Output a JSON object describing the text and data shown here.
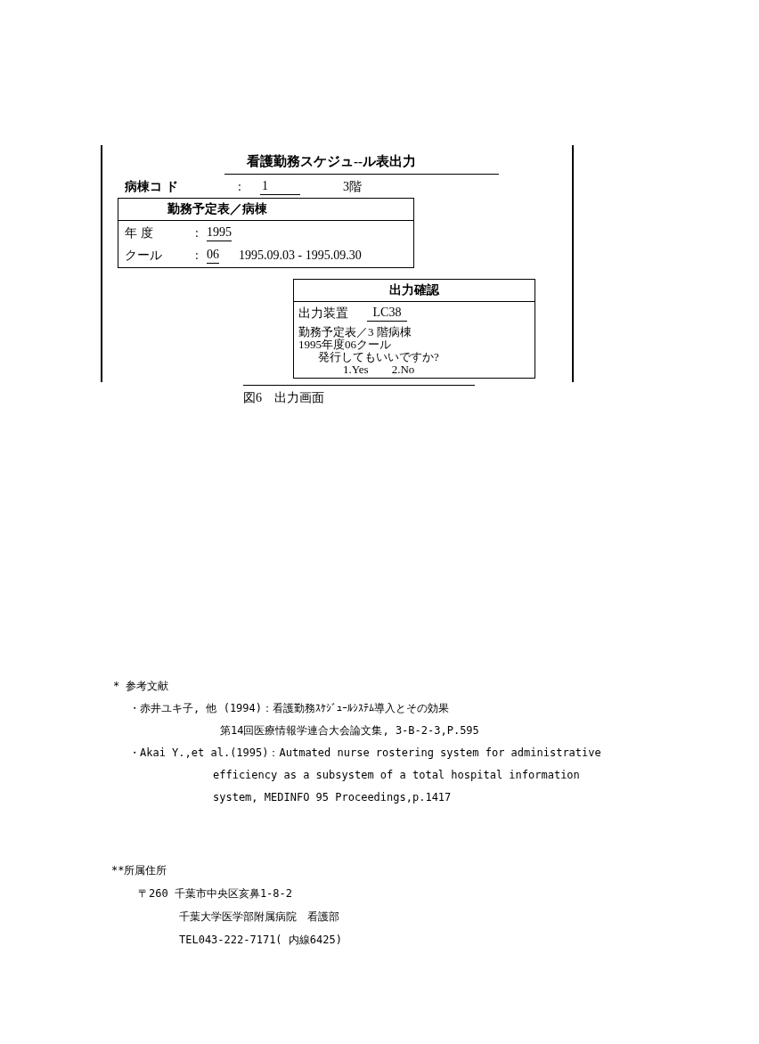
{
  "figure": {
    "title": "看護勤務スケジュ--ル表出力",
    "ward_code": {
      "label": "病棟コ ド",
      "separator": ":",
      "value": "1",
      "floor": "3階"
    },
    "schedule_panel": {
      "title": "勤務予定表／病棟",
      "rows": [
        {
          "label": "年 度",
          "separator": ":",
          "value": "1995"
        },
        {
          "label": "クール",
          "separator": ":",
          "value": "06",
          "range": "1995.09.03 - 1995.09.30"
        }
      ]
    },
    "dialog": {
      "title": "出力確認",
      "device_label": "出力装置",
      "device_value": "LC38",
      "lines": [
        "勤務予定表／3 階病棟",
        "1995年度06クール",
        "発行してもいいですか?"
      ],
      "options": [
        "1.Yes",
        "2.No"
      ]
    },
    "caption": "図6　出力画面"
  },
  "references": {
    "heading": "* 参考文献",
    "items": [
      {
        "lines": [
          "・赤井ユキ子, 他 (1994)：看護勤務ｽｹｼﾞｭｰﾙｼｽﾃﾑ導入とその効果",
          "第14回医療情報学連合大会論文集, 3-B-2-3,P.595"
        ]
      },
      {
        "lines": [
          "・Akai Y.,et al.(1995)：Autmated nurse rostering system for administrative",
          "efficiency as a subsystem of a total hospital information",
          "system, MEDINFO 95 Proceedings,p.1417"
        ]
      }
    ]
  },
  "affiliation": {
    "heading": "**所属住所",
    "lines": [
      "〒260 千葉市中央区亥鼻1-8-2",
      "千葉大学医学部附属病院　看護部",
      "TEL043-222-7171( 内線6425)"
    ]
  }
}
